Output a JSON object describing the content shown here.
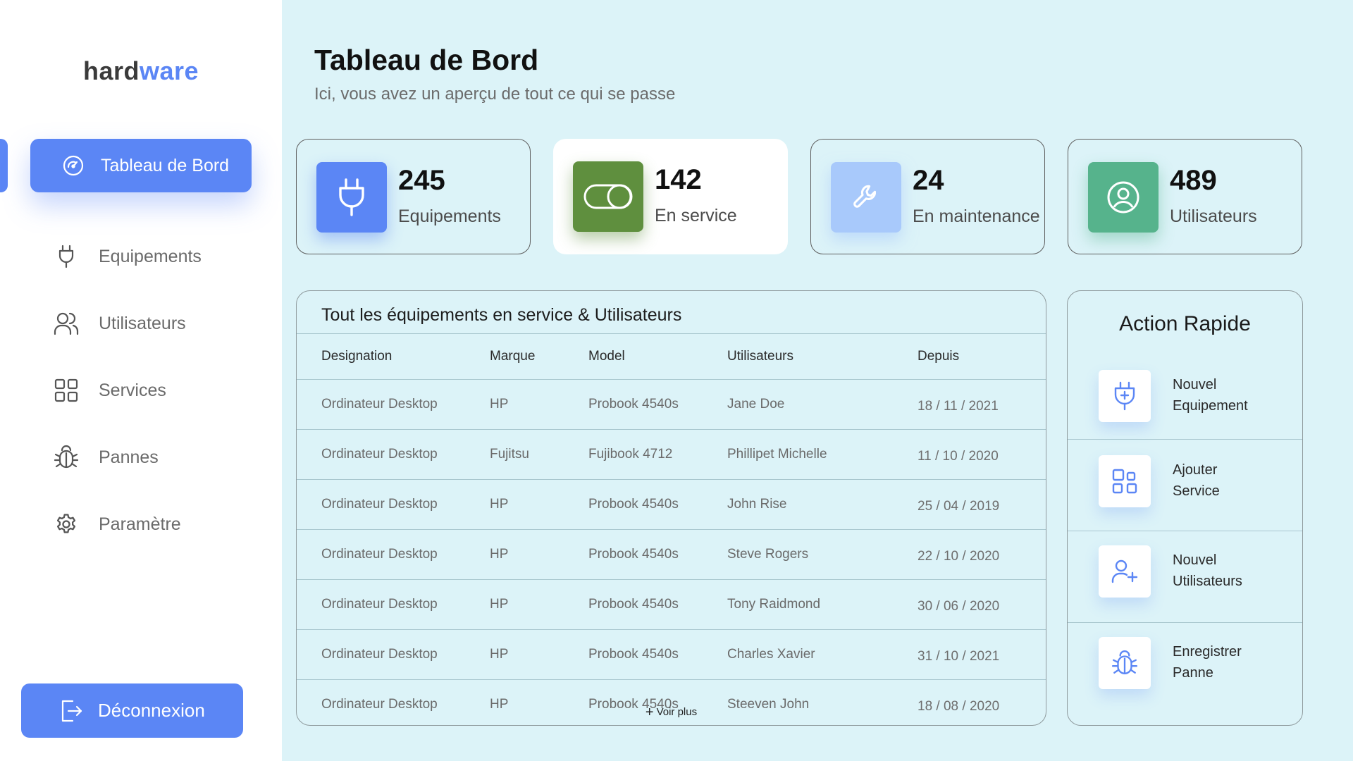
{
  "brand": {
    "part1": "hard",
    "part2": "ware"
  },
  "sidebar": {
    "active": {
      "label": "Tableau de Bord",
      "icon": "dashboard-gauge-icon"
    },
    "items": [
      {
        "label": "Equipements",
        "icon": "plug-icon"
      },
      {
        "label": "Utilisateurs",
        "icon": "users-icon"
      },
      {
        "label": "Services",
        "icon": "grid-icon"
      },
      {
        "label": "Pannes",
        "icon": "bug-icon"
      },
      {
        "label": "Paramètre",
        "icon": "gear-icon"
      }
    ],
    "logout": {
      "label": "Déconnexion",
      "icon": "logout-icon"
    }
  },
  "header": {
    "title": "Tableau de Bord",
    "subtitle": "Ici, vous avez un aperçu de tout ce qui se passe"
  },
  "stats": [
    {
      "value": "245",
      "label": "Equipements",
      "icon": "plug-icon",
      "color": "#5b86f5"
    },
    {
      "value": "142",
      "label": "En service",
      "icon": "toggle-icon",
      "color": "#5f8f3e"
    },
    {
      "value": "24",
      "label": "En maintenance",
      "icon": "wrench-icon",
      "color": "#a8c9fb"
    },
    {
      "value": "489",
      "label": "Utilisateurs",
      "icon": "user-circle-icon",
      "color": "#56b38c"
    }
  ],
  "table": {
    "title": "Tout les équipements en service & Utilisateurs",
    "headers": [
      "Designation",
      "Marque",
      "Model",
      "Utilisateurs",
      "Depuis"
    ],
    "rows": [
      [
        "Ordinateur Desktop",
        "HP",
        "Probook 4540s",
        "Jane Doe",
        "18 / 11 / 2021"
      ],
      [
        "Ordinateur Desktop",
        "Fujitsu",
        "Fujibook 4712",
        "Phillipet Michelle",
        "11 / 10 / 2020"
      ],
      [
        "Ordinateur Desktop",
        "HP",
        "Probook 4540s",
        "John Rise",
        "25 / 04 / 2019"
      ],
      [
        "Ordinateur Desktop",
        "HP",
        "Probook 4540s",
        "Steve Rogers",
        "22 / 10 / 2020"
      ],
      [
        "Ordinateur Desktop",
        "HP",
        "Probook 4540s",
        "Tony Raidmond",
        "30 / 06 / 2020"
      ],
      [
        "Ordinateur Desktop",
        "HP",
        "Probook 4540s",
        "Charles Xavier",
        "31 / 10 / 2021"
      ],
      [
        "Ordinateur Desktop",
        "HP",
        "Probook 4540s",
        "Steeven John",
        "18 / 08 / 2020"
      ]
    ],
    "more": "Voir plus"
  },
  "actions": {
    "title": "Action Rapide",
    "items": [
      {
        "line1": "Nouvel",
        "line2": "Equipement",
        "icon": "plug-plus-icon"
      },
      {
        "line1": "Ajouter",
        "line2": "Service",
        "icon": "grid-add-icon"
      },
      {
        "line1": "Nouvel",
        "line2": "Utilisateurs",
        "icon": "user-plus-icon"
      },
      {
        "line1": "Enregistrer",
        "line2": "Panne",
        "icon": "bug-icon"
      }
    ]
  },
  "colors": {
    "accent": "#5b86f5",
    "main_bg": "#dcf3f8"
  }
}
